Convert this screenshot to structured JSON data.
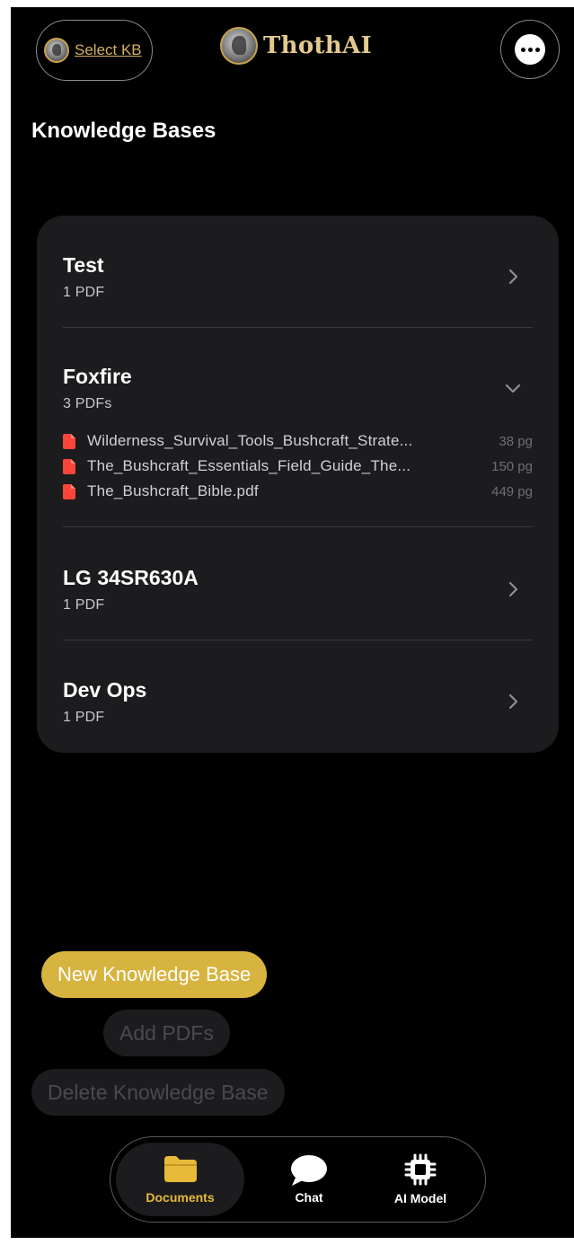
{
  "header": {
    "select_kb_label": "Select KB",
    "app_name": "ThothAI",
    "more_icon": "ellipsis-circle-icon"
  },
  "page": {
    "title": "Knowledge Bases"
  },
  "knowledge_bases": [
    {
      "name": "Test",
      "count": "1 PDF",
      "expanded": false
    },
    {
      "name": "Foxfire",
      "count": "3 PDFs",
      "expanded": true,
      "files": [
        {
          "name": "Wilderness_Survival_Tools_Bushcraft_Strate...",
          "pages": "38 pg"
        },
        {
          "name": "The_Bushcraft_Essentials_Field_Guide_The...",
          "pages": "150 pg"
        },
        {
          "name": "The_Bushcraft_Bible.pdf",
          "pages": "449 pg"
        }
      ]
    },
    {
      "name": "LG 34SR630A",
      "count": "1 PDF",
      "expanded": false
    },
    {
      "name": "Dev Ops",
      "count": "1 PDF",
      "expanded": false
    }
  ],
  "actions": {
    "new_kb": "New Knowledge Base",
    "add_pdfs": "Add PDFs",
    "delete_kb": "Delete Knowledge Base"
  },
  "tabs": [
    {
      "label": "Documents",
      "icon": "folder-icon",
      "active": true
    },
    {
      "label": "Chat",
      "icon": "chat-bubble-icon",
      "active": false
    },
    {
      "label": "AI Model",
      "icon": "chip-icon",
      "active": false
    }
  ],
  "colors": {
    "accent": "#d7b33f",
    "brand_gold": "#e3c98d",
    "pdf_red": "#ff453a",
    "card_bg": "#1c1c1e"
  }
}
